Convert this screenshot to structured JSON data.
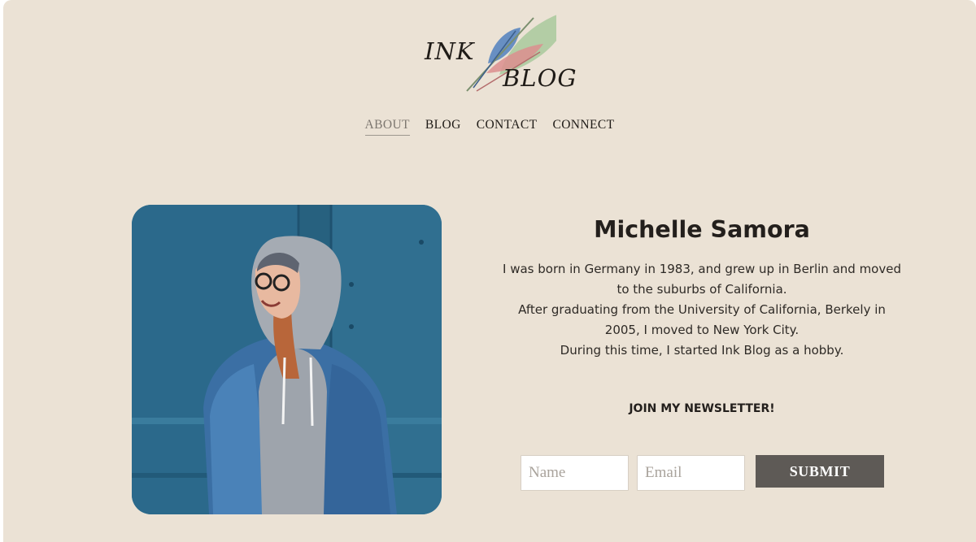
{
  "brand": {
    "word1": "INK",
    "word2": "BLOG",
    "colors": {
      "feather_blue": "#5a86c0",
      "feather_green": "#a9c99c",
      "feather_pink": "#dc8e8e"
    }
  },
  "nav": {
    "items": [
      {
        "label": "ABOUT",
        "active": true
      },
      {
        "label": "BLOG",
        "active": false
      },
      {
        "label": "CONTACT",
        "active": false
      },
      {
        "label": "CONNECT",
        "active": false
      }
    ]
  },
  "profile": {
    "name": "Michelle Samora",
    "bio_lines": [
      "I was born in Germany in 1983, and grew up in Berlin and moved",
      "to the suburbs of California.",
      "After graduating from the University of California, Berkely in",
      "2005, I moved to New York City.",
      "During this time, I started Ink Blog as a hobby."
    ]
  },
  "newsletter": {
    "heading": "JOIN MY NEWSLETTER!",
    "name_placeholder": "Name",
    "email_placeholder": "Email",
    "submit_label": "SUBMIT"
  },
  "theme": {
    "page_bg": "#ebe2d5",
    "text": "#231f1c",
    "button_bg": "#5e5a56",
    "photo_wall": "#2d6b8d"
  }
}
